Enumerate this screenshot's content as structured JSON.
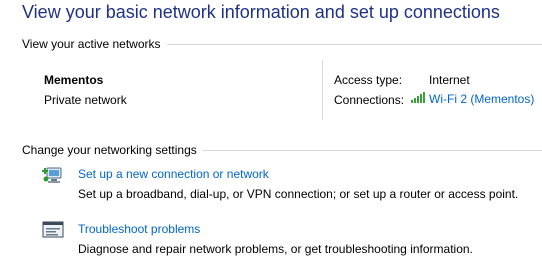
{
  "page_title": "View your basic network information and set up connections",
  "active_networks": {
    "header": "View your active networks",
    "network_name": "Mementos",
    "network_type": "Private network",
    "access_type_label": "Access type:",
    "access_type_value": "Internet",
    "connections_label": "Connections:",
    "connection_link": "Wi-Fi 2 (Mementos)",
    "connection_icon": "wifi-signal-icon"
  },
  "change_settings": {
    "header": "Change your networking settings",
    "tasks": [
      {
        "icon": "new-connection-icon",
        "link": "Set up a new connection or network",
        "description": "Set up a broadband, dial-up, or VPN connection; or set up a router or access point."
      },
      {
        "icon": "troubleshoot-icon",
        "link": "Troubleshoot problems",
        "description": "Diagnose and repair network problems, or get troubleshooting information."
      }
    ]
  },
  "colors": {
    "title": "#1e3287",
    "link": "#0066cc",
    "signal": "#3aa23a"
  }
}
